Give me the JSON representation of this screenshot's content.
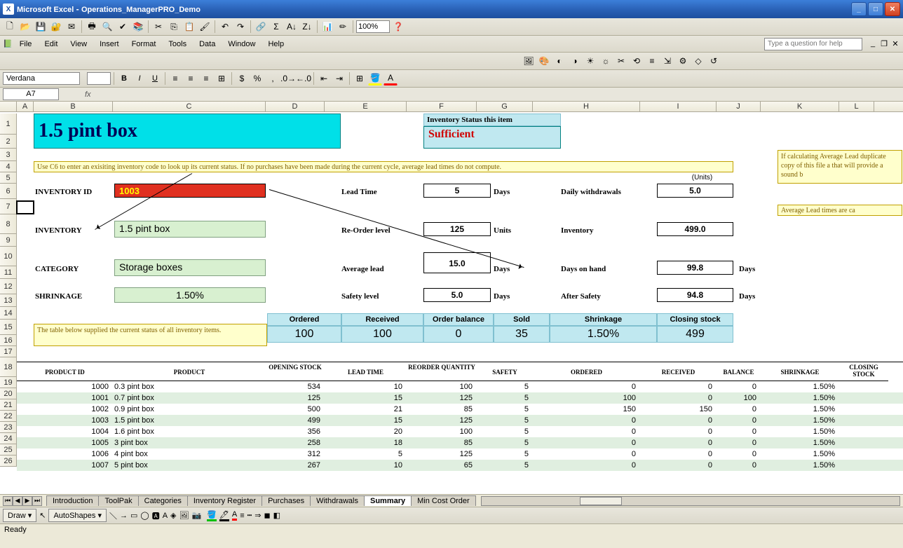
{
  "titlebar": {
    "app": "Microsoft Excel",
    "doc": "Operations_ManagerPRO_Demo"
  },
  "menus": {
    "file": "File",
    "edit": "Edit",
    "view": "View",
    "insert": "Insert",
    "format": "Format",
    "tools": "Tools",
    "data": "Data",
    "window": "Window",
    "help": "Help"
  },
  "help_placeholder": "Type a question for help",
  "zoom": "100%",
  "font_name": "Verdana",
  "font_size": "",
  "namebox": "A7",
  "columns": [
    "A",
    "B",
    "C",
    "D",
    "E",
    "F",
    "G",
    "H",
    "I",
    "J",
    "K",
    "L"
  ],
  "big_title": "1.5 pint box",
  "status_label": "Inventory Status this item",
  "status_value": "Sufficient",
  "units_label": "(Units)",
  "tip_c6": "Use C6 to enter an exisiting inventory code to look up its current status. If no purchases have been made during the current cycle, average lead times do not compute.",
  "side_note1": "If calculating Average Lead duplicate copy of this file a that will provide a sound b",
  "side_note2": "Average Lead times are ca",
  "labels": {
    "inventory_id": "INVENTORY ID",
    "inventory": "INVENTORY",
    "category": "CATEGORY",
    "shrinkage": "SHRINKAGE",
    "lead_time": "Lead Time",
    "reorder_level": "Re-Order level",
    "avg_lead": "Average lead",
    "safety_level": "Safety level",
    "daily_withdrawals": "Daily withdrawals",
    "inventory_r": "Inventory",
    "days_on_hand": "Days on hand",
    "after_safety": "After Safety",
    "days": "Days",
    "units": "Units"
  },
  "values": {
    "inventory_id": "1003",
    "inventory": "1.5 pint box",
    "category": "Storage boxes",
    "shrinkage": "1.50%",
    "lead_time": "5",
    "reorder_level": "125",
    "avg_lead": "15.0",
    "safety_level": "5.0",
    "daily_withdrawals": "5.0",
    "inventory_r": "499.0",
    "days_on_hand": "99.8",
    "after_safety": "94.8"
  },
  "summary_headers": [
    "Ordered",
    "Received",
    "Order balance",
    "Sold",
    "Shrinkage",
    "Closing stock"
  ],
  "summary_values": [
    "100",
    "100",
    "0",
    "35",
    "1.50%",
    "499"
  ],
  "table_note": "The table below supplied the current status of all inventory items.",
  "table_headers": [
    "PRODUCT ID",
    "PRODUCT",
    "OPENING STOCK",
    "LEAD TIME",
    "REORDER QUANTITY",
    "SAFETY",
    "ORDERED",
    "RECEIVED",
    "BALANCE",
    "SHRINKAGE",
    "CLOSING STOCK"
  ],
  "table_rows": [
    {
      "id": "1000",
      "product": "0.3 pint box",
      "open": "534",
      "lead": "10",
      "reorder": "100",
      "safety": "5",
      "ordered": "0",
      "received": "0",
      "balance": "0",
      "shrink": "1.50%"
    },
    {
      "id": "1001",
      "product": "0.7 pint box",
      "open": "125",
      "lead": "15",
      "reorder": "125",
      "safety": "5",
      "ordered": "100",
      "received": "0",
      "balance": "100",
      "shrink": "1.50%"
    },
    {
      "id": "1002",
      "product": "0.9 pint box",
      "open": "500",
      "lead": "21",
      "reorder": "85",
      "safety": "5",
      "ordered": "150",
      "received": "150",
      "balance": "0",
      "shrink": "1.50%"
    },
    {
      "id": "1003",
      "product": "1.5 pint box",
      "open": "499",
      "lead": "15",
      "reorder": "125",
      "safety": "5",
      "ordered": "0",
      "received": "0",
      "balance": "0",
      "shrink": "1.50%"
    },
    {
      "id": "1004",
      "product": "1.6 pint box",
      "open": "356",
      "lead": "20",
      "reorder": "100",
      "safety": "5",
      "ordered": "0",
      "received": "0",
      "balance": "0",
      "shrink": "1.50%"
    },
    {
      "id": "1005",
      "product": "3 pint box",
      "open": "258",
      "lead": "18",
      "reorder": "85",
      "safety": "5",
      "ordered": "0",
      "received": "0",
      "balance": "0",
      "shrink": "1.50%"
    },
    {
      "id": "1006",
      "product": "4 pint box",
      "open": "312",
      "lead": "5",
      "reorder": "125",
      "safety": "5",
      "ordered": "0",
      "received": "0",
      "balance": "0",
      "shrink": "1.50%"
    },
    {
      "id": "1007",
      "product": "5 pint box",
      "open": "267",
      "lead": "10",
      "reorder": "65",
      "safety": "5",
      "ordered": "0",
      "received": "0",
      "balance": "0",
      "shrink": "1.50%"
    }
  ],
  "sheet_tabs": [
    "Introduction",
    "ToolPak",
    "Categories",
    "Inventory Register",
    "Purchases",
    "Withdrawals",
    "Summary",
    "Min Cost Order"
  ],
  "active_tab": "Summary",
  "drawbar": {
    "draw": "Draw ▾",
    "autoshapes": "AutoShapes ▾"
  },
  "status": "Ready"
}
